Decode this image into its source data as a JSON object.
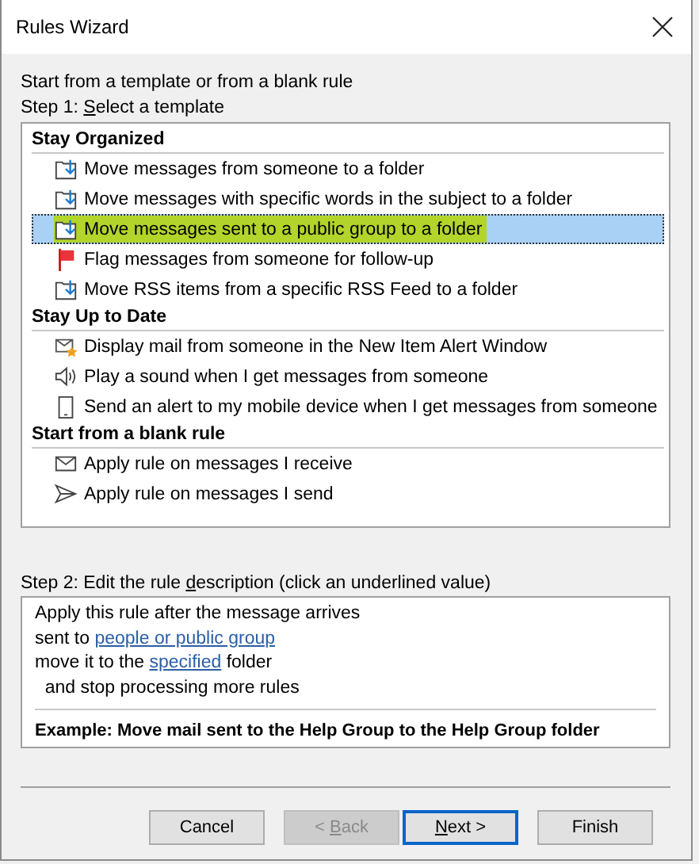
{
  "window": {
    "title": "Rules Wizard"
  },
  "intro": "Start from a template or from a blank rule",
  "step1": [
    {
      "text": "Step 1: ",
      "underline": false
    },
    {
      "text": "S",
      "underline": true
    },
    {
      "text": "elect a template",
      "underline": false
    }
  ],
  "groups": [
    {
      "title": "Stay Organized",
      "items": [
        {
          "label": "Move messages from someone to a folder",
          "kind": "move",
          "selected": false,
          "highlighted": false
        },
        {
          "label": "Move messages with specific words in the subject to a folder",
          "kind": "move",
          "selected": false,
          "highlighted": false
        },
        {
          "label": "Move messages sent to a public group to a folder",
          "kind": "move",
          "selected": true,
          "highlighted": true
        },
        {
          "label": "Flag messages from someone for follow-up",
          "kind": "flag",
          "selected": false,
          "highlighted": false
        },
        {
          "label": "Move RSS items from a specific RSS Feed to a folder",
          "kind": "move",
          "selected": false,
          "highlighted": false
        }
      ]
    },
    {
      "title": "Stay Up to Date",
      "items": [
        {
          "label": "Display mail from someone in the New Item Alert Window",
          "kind": "alert",
          "selected": false,
          "highlighted": false
        },
        {
          "label": "Play a sound when I get messages from someone",
          "kind": "sound",
          "selected": false,
          "highlighted": false
        },
        {
          "label": "Send an alert to my mobile device when I get messages from someone",
          "kind": "mobile",
          "selected": false,
          "highlighted": false
        }
      ]
    },
    {
      "title": "Start from a blank rule",
      "items": [
        {
          "label": "Apply rule on messages I receive",
          "kind": "receive",
          "selected": false,
          "highlighted": false
        },
        {
          "label": "Apply rule on messages I send",
          "kind": "send",
          "selected": false,
          "highlighted": false
        }
      ]
    }
  ],
  "step2": [
    {
      "text": "Step 2: Edit the rule ",
      "underline": false
    },
    {
      "text": "d",
      "underline": true
    },
    {
      "text": "escription (click an underlined value)",
      "underline": false
    }
  ],
  "description": [
    [
      {
        "text": "Apply this rule after the message arrives",
        "link": false
      }
    ],
    [
      {
        "text": "sent to ",
        "link": false
      },
      {
        "text": "people or public group",
        "link": true
      }
    ],
    [
      {
        "text": "move it to the ",
        "link": false
      },
      {
        "text": "specified",
        "link": true
      },
      {
        "text": " folder",
        "link": false
      }
    ],
    [
      {
        "text": "  and stop processing more rules",
        "link": false
      }
    ]
  ],
  "example": "Example: Move mail sent to the Help Group to the Help Group folder",
  "buttons": [
    {
      "parts": [
        {
          "text": "Cancel",
          "underline": false
        }
      ],
      "disabled": false,
      "default": false
    },
    {
      "parts": [
        {
          "text": "< ",
          "underline": false
        },
        {
          "text": "B",
          "underline": true
        },
        {
          "text": "ack",
          "underline": false
        }
      ],
      "disabled": true,
      "default": false
    },
    {
      "parts": [
        {
          "text": "N",
          "underline": true
        },
        {
          "text": "ext >",
          "underline": false
        }
      ],
      "disabled": false,
      "default": true
    },
    {
      "parts": [
        {
          "text": "Finish",
          "underline": false
        }
      ],
      "disabled": false,
      "default": false
    }
  ]
}
